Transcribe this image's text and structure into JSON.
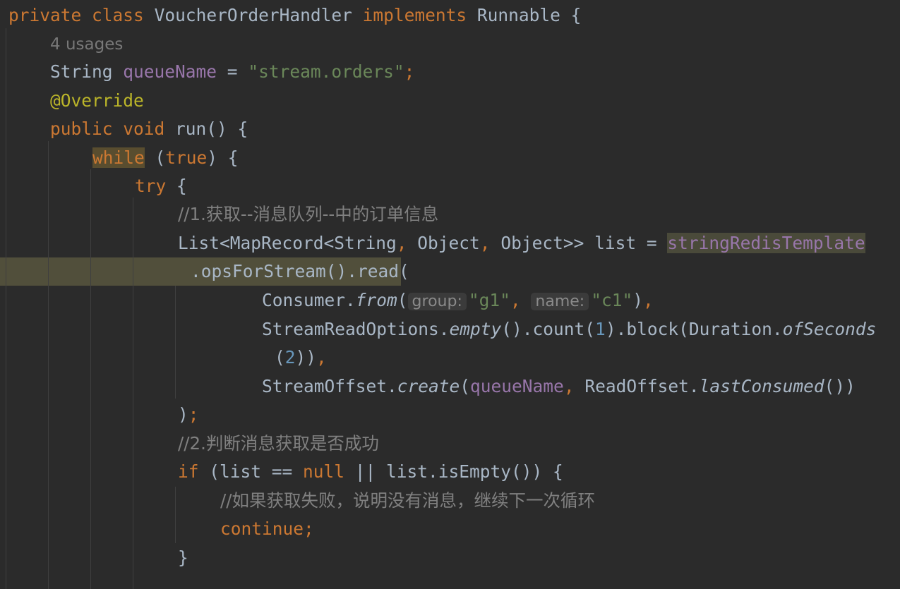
{
  "code": {
    "l1": {
      "private": "private",
      "class": "class",
      "class_name": "VoucherOrderHandler",
      "implements": "implements",
      "iface": "Runnable",
      "brace": " {"
    },
    "l2": {
      "usages": "4 usages"
    },
    "l3": {
      "type": "String",
      "name": "queueName",
      "eq": " = ",
      "value": "\"stream.orders\"",
      "semi": ";"
    },
    "l4": {
      "annotation": "@Override"
    },
    "l5": {
      "public": "public",
      "void": "void",
      "method": " run() {"
    },
    "l6": {
      "while": "while",
      "open": " (",
      "true": "true",
      "close": ") {"
    },
    "l7": {
      "try": "try",
      "brace": " {"
    },
    "l8": {
      "comment": "//1.获取--消息队列--中的订单信息"
    },
    "l9": {
      "decl": "List<MapRecord<String",
      "c1": ",",
      "obj1": " Object",
      "c2": ",",
      "obj2": " Object>> list = ",
      "field": "stringRedisTemplate"
    },
    "l10": {
      "text": ".opsForStream().read("
    },
    "l11": {
      "consumer": "Consumer.",
      "from": "from",
      "paren": "(",
      "hint_group": "group:",
      "g1": "\"g1\"",
      "comma1": ", ",
      "hint_name": "name:",
      "c1": "\"c1\"",
      "end": ")",
      "comma2": ","
    },
    "l12": {
      "sro": "StreamReadOptions.",
      "empty": "empty",
      "mid": "().count(",
      "one": "1",
      "block": ").block(Duration.",
      "ofseconds": "ofSeconds"
    },
    "l13": {
      "open": "(",
      "two": "2",
      "close": "))",
      "comma": ","
    },
    "l14": {
      "so": "StreamOffset.",
      "create": "create",
      "paren": "(",
      "qn": "queueName",
      "comma": ",",
      "ro": " ReadOffset.",
      "last": "lastConsumed",
      "end": "())"
    },
    "l15": {
      "close": ")",
      "semi": ";"
    },
    "l16": {
      "comment": "//2.判断消息获取是否成功"
    },
    "l17": {
      "if": "if",
      "cond": " (list == ",
      "null": "null",
      "rest": " || list.isEmpty()) {"
    },
    "l18": {
      "comment": "//如果获取失败，说明没有消息，继续下一次循环"
    },
    "l19": {
      "continue": "continue",
      "semi": ";"
    },
    "l20": {
      "brace": "}"
    }
  }
}
